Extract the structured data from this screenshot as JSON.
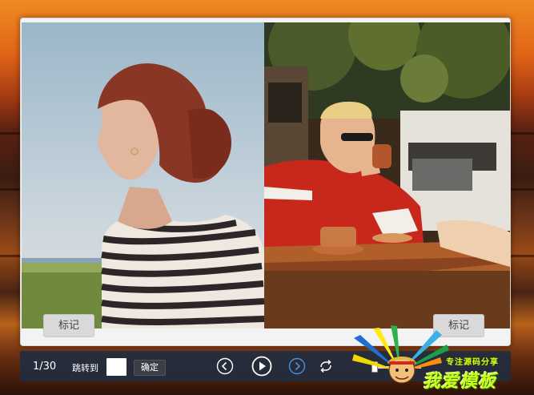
{
  "viewer": {
    "photos": [
      {
        "name": "woman-striped-shirt-photo"
      },
      {
        "name": "man-drinking-cafe-photo"
      }
    ],
    "mark_left_label": "标记",
    "mark_right_label": "标记"
  },
  "toolbar": {
    "counter": "1/30",
    "jump_label": "跳转到",
    "jump_value": "",
    "confirm_label": "确定",
    "controls": {
      "prev": "chevron-left-icon",
      "play": "play-icon",
      "next": "chevron-right-icon",
      "loop": "repeat-icon"
    },
    "accent_color": "#4a90d9"
  },
  "watermark": {
    "tagline": "专注源码分享",
    "name": "我爱模板"
  }
}
